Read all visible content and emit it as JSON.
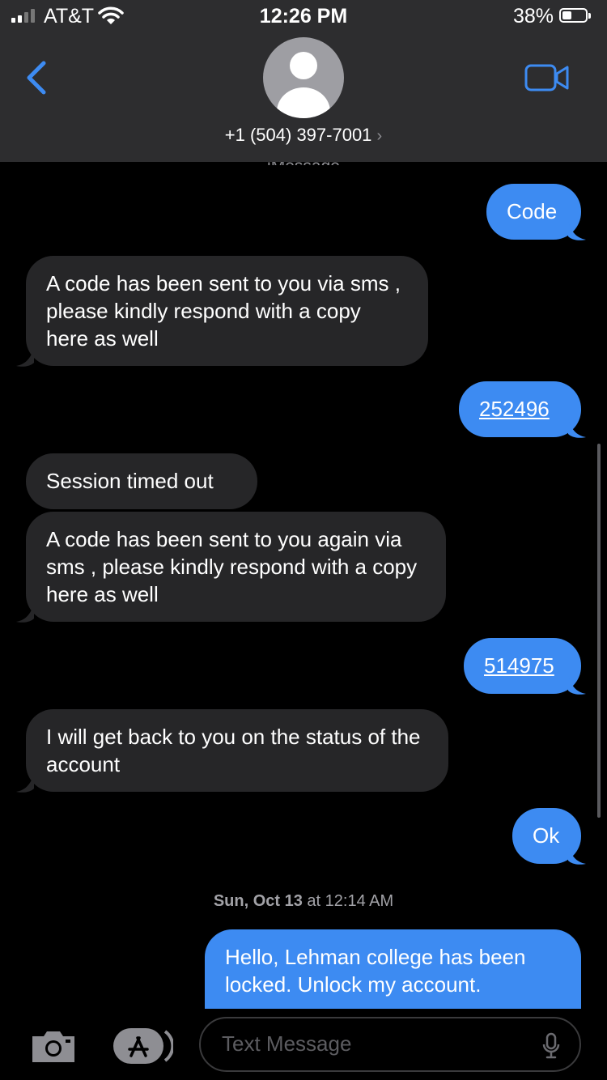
{
  "status_bar": {
    "carrier": "AT&T",
    "time": "12:26 PM",
    "battery_percent": "38%",
    "signal_bars": 2,
    "battery_level": 0.38
  },
  "header": {
    "contact_number": "+1 (504) 397-7001",
    "chevron": "›",
    "partial_label": "iMessage",
    "icons": [
      "back-chevron-icon",
      "contact-avatar-icon",
      "video-call-icon"
    ]
  },
  "messages": [
    {
      "from": "me",
      "text": "Code"
    },
    {
      "from": "them",
      "text": "A code has been sent to you  via sms , please kindly respond with a copy here as well"
    },
    {
      "from": "me",
      "text": "252496",
      "link": true
    },
    {
      "from": "them",
      "text": "Session timed out"
    },
    {
      "from": "them",
      "text": "A code has been sent to you again via sms , please kindly respond with a copy here as well"
    },
    {
      "from": "me",
      "text": "514975",
      "link": true
    },
    {
      "from": "them",
      "text": "I will get back to you on the status of the account"
    },
    {
      "from": "me",
      "text": "Ok"
    }
  ],
  "date_separator": {
    "day": "Sun, Oct 13",
    "at": "at 12:14 AM"
  },
  "last_message": {
    "from": "me",
    "text": "Hello, Lehman college has been locked. Unlock my account."
  },
  "composer": {
    "placeholder": "Text Message",
    "icons": [
      "camera-icon",
      "app-store-icon",
      "microphone-icon"
    ]
  },
  "colors": {
    "outgoing_bubble": "#3d8bf2",
    "incoming_bubble": "#262628",
    "header_background": "#2d2d2f",
    "accent": "#3d8bf2"
  }
}
